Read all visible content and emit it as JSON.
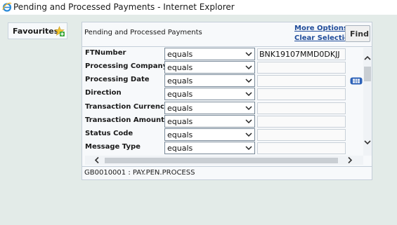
{
  "window": {
    "title": "Pending and Processed Payments - Internet Explorer",
    "icon": "internet-explorer-icon"
  },
  "favourites": {
    "label": "Favourites",
    "icon": "favourites-add-icon"
  },
  "panel": {
    "title": "Pending and Processed Payments",
    "more_options": "More Options",
    "clear_selection": "Clear Selection",
    "find": "Find"
  },
  "criteria": [
    {
      "label": "FTNumber",
      "operator": "equals",
      "value": "BNK19107MMD0DKJJ"
    },
    {
      "label": "Processing Company",
      "operator": "equals",
      "value": ""
    },
    {
      "label": "Processing Date",
      "operator": "equals",
      "value": "",
      "icon": "calendar-icon"
    },
    {
      "label": "Direction",
      "operator": "equals",
      "value": ""
    },
    {
      "label": "Transaction Currency",
      "operator": "equals",
      "value": ""
    },
    {
      "label": "Transaction Amount",
      "operator": "equals",
      "value": ""
    },
    {
      "label": "Status Code",
      "operator": "equals",
      "value": ""
    },
    {
      "label": "Message Type",
      "operator": "equals",
      "value": ""
    }
  ],
  "status_bar": {
    "text": "GB0010001 : PAY.PEN.PROCESS"
  },
  "colors": {
    "background": "#e3ebe8",
    "link": "#1f4b99",
    "panel": "#f7f9fb",
    "border": "#c4ced9"
  }
}
